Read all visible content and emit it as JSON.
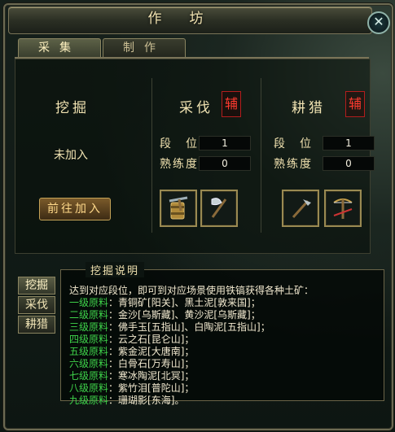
{
  "window": {
    "title": "作坊"
  },
  "tabs": [
    {
      "label": "采集",
      "active": true
    },
    {
      "label": "制作",
      "active": false
    }
  ],
  "left": {
    "skill_name": "挖掘",
    "status": "未加入",
    "join_button": "前往加入"
  },
  "middle": {
    "skill_name": "采伐",
    "badge": "辅",
    "rank_label": "段　位",
    "rank_value": "1",
    "prof_label": "熟练度",
    "prof_value": "0",
    "items": [
      "pickaxe-bucket-icon",
      "axe-icon"
    ]
  },
  "right": {
    "skill_name": "耕猎",
    "badge": "辅",
    "rank_label": "段　位",
    "rank_value": "1",
    "prof_label": "熟练度",
    "prof_value": "0",
    "items": [
      "hoe-icon",
      "bow-crossbow-icon"
    ]
  },
  "side_buttons": [
    {
      "label": "挖掘",
      "active": true
    },
    {
      "label": "采伐",
      "active": false
    },
    {
      "label": "耕猎",
      "active": false
    }
  ],
  "description": {
    "title": "挖掘说明",
    "intro": "达到对应段位，即可到对应场景使用铁镐获得各种土矿：",
    "rows": [
      {
        "level": "一级原料",
        "text": "：青铜矿[阳关]、黑土泥[敦来国]；"
      },
      {
        "level": "二级原料",
        "text": "：金沙[乌斯藏]、黄沙泥[乌斯藏]；"
      },
      {
        "level": "三级原料",
        "text": "：佛手玉[五指山]、白陶泥[五指山]；"
      },
      {
        "level": "四级原料",
        "text": "：云之石[昆仑山]；"
      },
      {
        "level": "五级原料",
        "text": "：紫金泥[大唐南]；"
      },
      {
        "level": "六级原料",
        "text": "：白骨石[万寿山]；"
      },
      {
        "level": "七级原料",
        "text": "：寒冰陶泥[北冥]；"
      },
      {
        "level": "八级原料",
        "text": "：紫竹泪[普陀山]；"
      },
      {
        "level": "九级原料",
        "text": "：珊瑚影[东海]。"
      }
    ]
  },
  "colors": {
    "level_green": "#3ed24a",
    "badge_red": "#ff3b2f",
    "gold_text": "#f1e3b2"
  }
}
